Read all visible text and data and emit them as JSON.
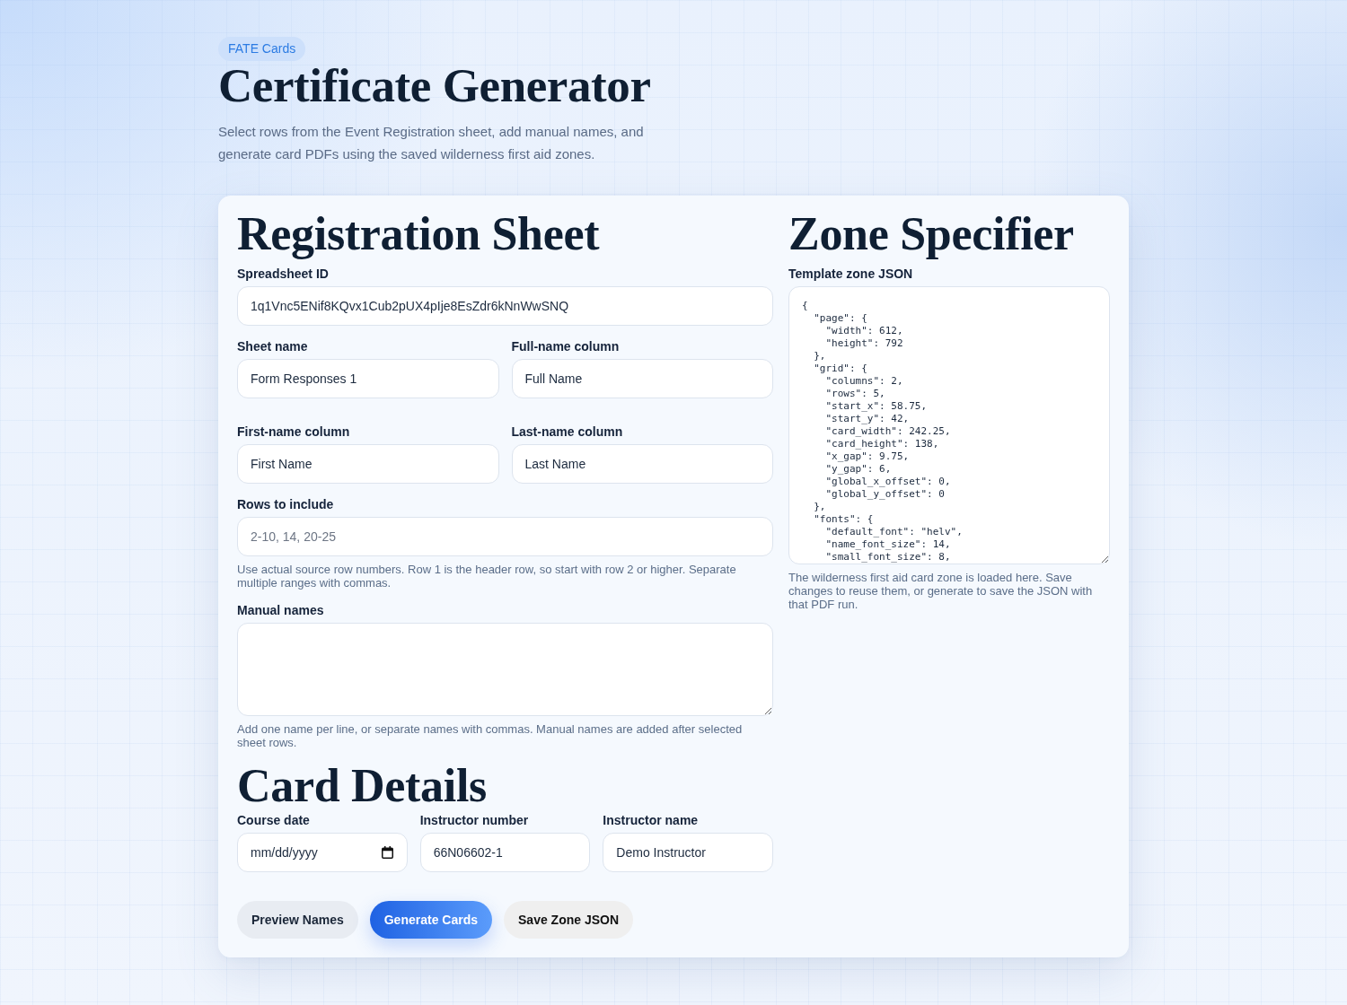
{
  "header": {
    "badge": "FATE Cards",
    "title": "Certificate Generator",
    "description": "Select rows from the Event Registration sheet, add manual names, and generate card PDFs using the saved wilderness first aid zones."
  },
  "registration_sheet": {
    "heading": "Registration Sheet",
    "spreadsheet_id": {
      "label": "Spreadsheet ID",
      "value": "1q1Vnc5ENif8KQvx1Cub2pUX4pIje8EsZdr6kNnWwSNQ"
    },
    "column_fields": [
      {
        "label": "Sheet name",
        "value": "Form Responses 1"
      },
      {
        "label": "Full-name column",
        "value": "Full Name"
      },
      {
        "label": "First-name column",
        "value": "First Name"
      },
      {
        "label": "Last-name column",
        "value": "Last Name"
      }
    ],
    "rows_to_include": {
      "label": "Rows to include",
      "placeholder": "2-10, 14, 20-25",
      "help": "Use actual source row numbers. Row 1 is the header row, so start with row 2 or higher. Separate multiple ranges with commas."
    },
    "manual_names": {
      "label": "Manual names",
      "help": "Add one name per line, or separate names with commas. Manual names are added after selected sheet rows."
    }
  },
  "card_details": {
    "heading": "Card Details",
    "fields": [
      {
        "kind": "date",
        "label": "Course date",
        "placeholder": "mm/dd/yyyy"
      },
      {
        "kind": "text",
        "label": "Instructor number",
        "value": "66N06602-1"
      },
      {
        "kind": "text",
        "label": "Instructor name",
        "value": "Demo Instructor"
      }
    ]
  },
  "actions": [
    {
      "label": "Preview Names",
      "kind": "secondary"
    },
    {
      "label": "Generate Cards",
      "kind": "primary"
    },
    {
      "label": "Save Zone JSON",
      "kind": "neutral"
    }
  ],
  "zone_specifier": {
    "heading": "Zone Specifier",
    "label": "Template zone JSON",
    "value": "{\n  \"page\": {\n    \"width\": 612,\n    \"height\": 792\n  },\n  \"grid\": {\n    \"columns\": 2,\n    \"rows\": 5,\n    \"start_x\": 58.75,\n    \"start_y\": 42,\n    \"card_width\": 242.25,\n    \"card_height\": 138,\n    \"x_gap\": 9.75,\n    \"y_gap\": 6,\n    \"global_x_offset\": 0,\n    \"global_y_offset\": 0\n  },\n  \"fonts\": {\n    \"default_font\": \"helv\",\n    \"name_font_size\": 14,\n    \"small_font_size\": 8,",
    "help": "The wilderness first aid card zone is loaded here. Save changes to reuse them, or generate to save the JSON with that PDF run."
  }
}
